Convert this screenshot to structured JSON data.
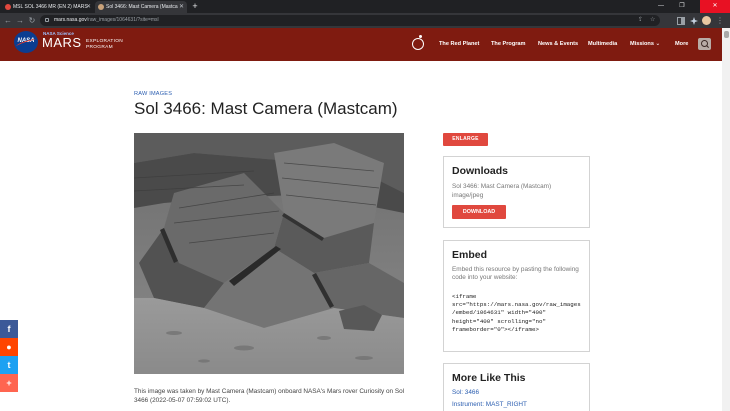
{
  "browser": {
    "tabs": [
      {
        "title": "MSL SOL 3466 MR (EN 2) MARS",
        "active": false,
        "favicon_color": "#e0483e"
      },
      {
        "title": "Sol 3466: Mast Camera (Mastca",
        "active": true,
        "favicon_color": "#c9a27a"
      }
    ],
    "new_tab_label": "+",
    "address_bar": {
      "domain": "mars.nasa.gov",
      "path": "/raw_images/1064631/?site=msl"
    },
    "window_controls": {
      "minimize": "—",
      "maximize": "❐",
      "close": "✕"
    }
  },
  "site_header": {
    "nasa_wordmark": "NASA",
    "nasa_science": "NASA Science",
    "mars": "MARS",
    "program_line1": "EXPLORATION",
    "program_line2": "PROGRAM",
    "nav": [
      "The Red Planet",
      "The Program",
      "News & Events",
      "Multimedia",
      "Missions",
      "More"
    ],
    "missions_caret": "⌄"
  },
  "page": {
    "breadcrumb": "RAW IMAGES",
    "title": "Sol 3466: Mast Camera (Mastcam)",
    "caption": "This image was taken by Mast Camera (Mastcam) onboard NASA's Mars rover Curiosity on Sol 3466 (2022-05-07 07:59:02 UTC)."
  },
  "sidebar": {
    "enlarge_label": "ENLARGE",
    "downloads": {
      "heading": "Downloads",
      "file_name": "Sol 3466: Mast Camera (Mastcam)",
      "file_type": "image/jpeg",
      "button": "DOWNLOAD"
    },
    "embed": {
      "heading": "Embed",
      "description": "Embed this resource by pasting the following code into your website:",
      "code_lines": [
        "<iframe",
        "src=\"https://mars.nasa.gov/raw_images",
        "/embed/1064631\" width=\"400\"",
        "height=\"400\" scrolling=\"no\"",
        "frameborder=\"0\"></iframe>"
      ]
    },
    "more_like_this": {
      "heading": "More Like This",
      "links": [
        "Sol: 3466",
        "Instrument: MAST_RIGHT"
      ]
    }
  },
  "share": [
    {
      "name": "facebook",
      "glyph": "f",
      "color": "#3b5998"
    },
    {
      "name": "reddit",
      "glyph": "●",
      "color": "#ff4500"
    },
    {
      "name": "twitter",
      "glyph": "t",
      "color": "#1da1f2"
    },
    {
      "name": "more",
      "glyph": "+",
      "color": "#ff6550"
    }
  ],
  "icons": {
    "back": "←",
    "forward": "→",
    "reload": "↻",
    "share_page": "⇪",
    "bookmark": "☆",
    "extensions": "▮",
    "kebab": "⋮"
  }
}
